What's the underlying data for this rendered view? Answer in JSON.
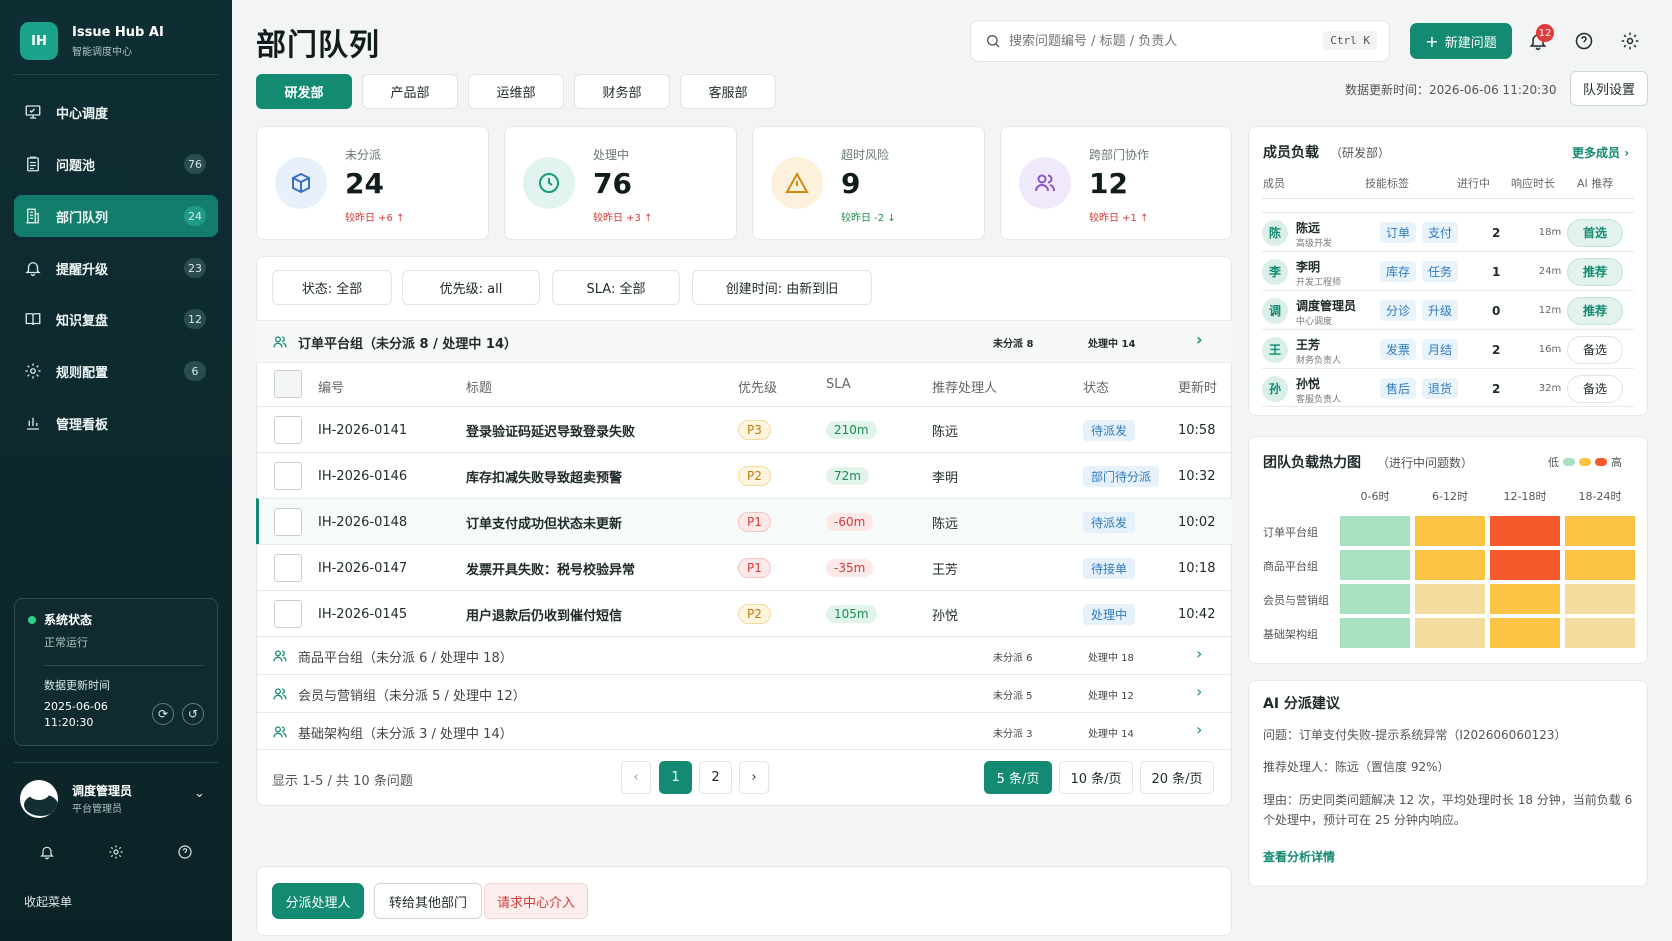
{
  "brand": {
    "logo": "IH",
    "name": "Issue Hub AI",
    "subtitle": "智能调度中心"
  },
  "nav": [
    {
      "label": "中心调度",
      "icon": "monitor-icon",
      "badge": ""
    },
    {
      "label": "问题池",
      "icon": "clipboard-icon",
      "badge": "76"
    },
    {
      "label": "部门队列",
      "icon": "building-icon",
      "badge": "24",
      "active": true
    },
    {
      "label": "提醒升级",
      "icon": "bell-icon",
      "badge": "23"
    },
    {
      "label": "知识复盘",
      "icon": "book-icon",
      "badge": "12"
    },
    {
      "label": "规则配置",
      "icon": "gear-icon",
      "badge": "6"
    },
    {
      "label": "管理看板",
      "icon": "bar-chart-icon",
      "badge": ""
    }
  ],
  "system_status": {
    "title": "系统状态",
    "state": "正常运行",
    "update_label": "数据更新时间",
    "date": "2025-06-06",
    "time": "11:20:30"
  },
  "user": {
    "name": "调度管理员",
    "role": "平台管理员"
  },
  "collapse_label": "收起菜单",
  "header": {
    "title": "部门队列",
    "search_placeholder": "搜索问题编号 / 标题 / 负责人",
    "search_shortcut": "Ctrl K",
    "new_button": "新建问题",
    "notif_count": "12",
    "update_text": "数据更新时间：2026-06-06 11:20:30",
    "queue_settings": "队列设置"
  },
  "tabs": [
    "研发部",
    "产品部",
    "运维部",
    "财务部",
    "客服部"
  ],
  "stats": [
    {
      "label": "未分派",
      "value": "24",
      "delta": "较昨日 +6 ↑",
      "delta_color": "#d23b3b",
      "icon": "cube-icon",
      "bg": "#e8f0fb",
      "fg": "#3a6fc4"
    },
    {
      "label": "处理中",
      "value": "76",
      "delta": "较昨日 +3 ↑",
      "delta_color": "#d23b3b",
      "icon": "clock-icon",
      "bg": "#e2f4ef",
      "fg": "#169a7c"
    },
    {
      "label": "超时风险",
      "value": "9",
      "delta": "较昨日 -2 ↓",
      "delta_color": "#1f8f4d",
      "icon": "warning-icon",
      "bg": "#fdf1dc",
      "fg": "#d08a12"
    },
    {
      "label": "跨部门协作",
      "value": "12",
      "delta": "较昨日 +1 ↑",
      "delta_color": "#d23b3b",
      "icon": "users-icon",
      "bg": "#f0e8fb",
      "fg": "#8758c9"
    }
  ],
  "filters": [
    "状态: 全部",
    "优先级: all",
    "SLA: 全部",
    "创建时间: 由新到旧"
  ],
  "main_group": {
    "title": "订单平台组（未分派 8 / 处理中 14）",
    "unassigned": "未分派 8",
    "in_progress": "处理中 14"
  },
  "table_headers": [
    "编号",
    "标题",
    "优先级",
    "SLA",
    "推荐处理人",
    "状态",
    "更新时"
  ],
  "rows": [
    {
      "id": "IH-2026-0141",
      "title": "登录验证码延迟导致登录失败",
      "priority": "P3",
      "sla": "210m",
      "assignee": "陈远",
      "status": "待派发",
      "time": "10:58"
    },
    {
      "id": "IH-2026-0146",
      "title": "库存扣减失败导致超卖预警",
      "priority": "P2",
      "sla": "72m",
      "assignee": "李明",
      "status": "部门待分派",
      "time": "10:32"
    },
    {
      "id": "IH-2026-0148",
      "title": "订单支付成功但状态未更新",
      "priority": "P1",
      "sla": "-60m",
      "assignee": "陈远",
      "status": "待派发",
      "time": "10:02"
    },
    {
      "id": "IH-2026-0147",
      "title": "发票开具失败：税号校验异常",
      "priority": "P1",
      "sla": "-35m",
      "assignee": "王芳",
      "status": "待接单",
      "time": "10:18"
    },
    {
      "id": "IH-2026-0145",
      "title": "用户退款后仍收到催付短信",
      "priority": "P2",
      "sla": "105m",
      "assignee": "孙悦",
      "status": "处理中",
      "time": "10:42"
    }
  ],
  "other_groups": [
    {
      "title": "商品平台组（未分派 6 / 处理中 18）",
      "unassigned": "未分派 6",
      "in_progress": "处理中 18"
    },
    {
      "title": "会员与营销组（未分派 5 / 处理中 12）",
      "unassigned": "未分派 5",
      "in_progress": "处理中 12"
    },
    {
      "title": "基础架构组（未分派 3 / 处理中 14）",
      "unassigned": "未分派 3",
      "in_progress": "处理中 14"
    }
  ],
  "pagination": {
    "summary": "显示 1-5 / 共 10 条问题",
    "prev": "‹",
    "next": "›",
    "pages": [
      "1",
      "2"
    ],
    "sizes": [
      "5 条/页",
      "10 条/页",
      "20 条/页"
    ]
  },
  "actions": [
    "分派处理人",
    "转给其他部门",
    "请求中心介入"
  ],
  "members": {
    "title": "成员负载",
    "dept": "（研发部）",
    "more": "更多成员 ›",
    "headers": [
      "成员",
      "技能标签",
      "进行中",
      "响应时长",
      "AI 推荐"
    ],
    "list": [
      {
        "initial": "陈",
        "name": "陈远",
        "role": "高级开发",
        "tags": [
          "订单",
          "支付"
        ],
        "active": "2",
        "resp": "18m",
        "ai": "首选",
        "ai_style": "strong"
      },
      {
        "initial": "李",
        "name": "李明",
        "role": "开发工程师",
        "tags": [
          "库存",
          "任务"
        ],
        "active": "1",
        "resp": "24m",
        "ai": "推荐",
        "ai_style": "strong"
      },
      {
        "initial": "调",
        "name": "调度管理员",
        "role": "中心调度",
        "tags": [
          "分诊",
          "升级"
        ],
        "active": "0",
        "resp": "12m",
        "ai": "推荐",
        "ai_style": "strong"
      },
      {
        "initial": "王",
        "name": "王芳",
        "role": "财务负责人",
        "tags": [
          "发票",
          "月结"
        ],
        "active": "2",
        "resp": "16m",
        "ai": "备选",
        "ai_style": "plain"
      },
      {
        "initial": "孙",
        "name": "孙悦",
        "role": "客服负责人",
        "tags": [
          "售后",
          "退货"
        ],
        "active": "2",
        "resp": "32m",
        "ai": "备选",
        "ai_style": "plain"
      }
    ]
  },
  "heatmap": {
    "title": "团队负载热力图",
    "subtitle": "（进行中问题数）",
    "low": "低",
    "high": "高",
    "cols": [
      "0-6时",
      "6-12时",
      "12-18时",
      "18-24时"
    ],
    "rows": [
      "订单平台组",
      "商品平台组",
      "会员与营销组",
      "基础架构组"
    ],
    "levels": [
      [
        1,
        3,
        4,
        3
      ],
      [
        1,
        3,
        4,
        3
      ],
      [
        1,
        2,
        3,
        2
      ],
      [
        1,
        2,
        3,
        2
      ]
    ],
    "colors": [
      "#a8e2c0",
      "#f2dd9e",
      "#fbc444",
      "#f55a2c"
    ]
  },
  "ai": {
    "title": "AI 分派建议",
    "issue": "问题：订单支付失败-提示系统异常（I202606060123）",
    "recommend": "推荐处理人：陈远（置信度 92%）",
    "reason": "理由：历史同类问题解决 12 次，平均处理时长 18 分钟，当前负载 6 个处理中，预计可在 25 分钟内响应。",
    "link": "查看分析详情"
  }
}
